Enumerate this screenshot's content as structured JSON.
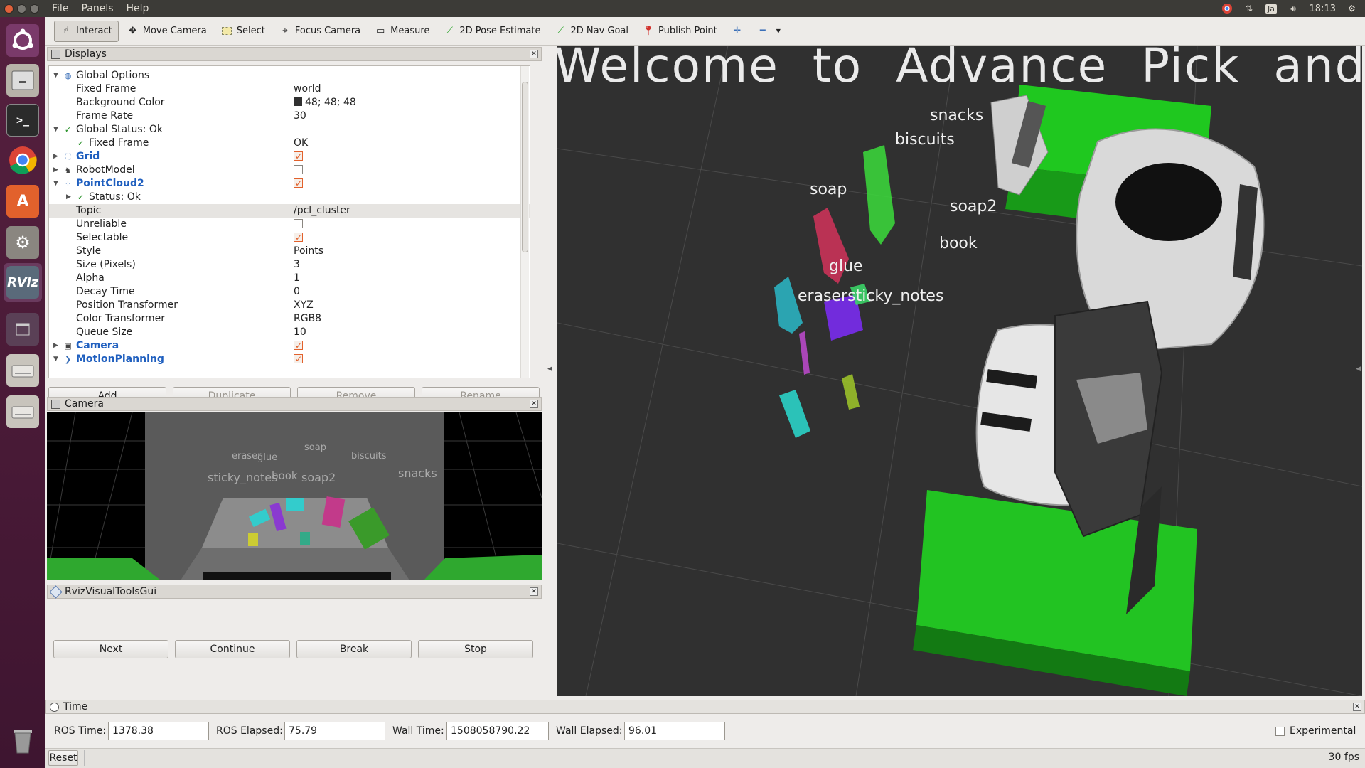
{
  "menubar": {
    "menus": [
      "File",
      "Panels",
      "Help"
    ],
    "clock": "18:13",
    "keyboard": "Ja"
  },
  "toolbar": {
    "tools": [
      {
        "label": "Interact",
        "icon": "hand-icon",
        "active": true
      },
      {
        "label": "Move Camera",
        "icon": "move-camera-icon"
      },
      {
        "label": "Select",
        "icon": "select-icon"
      },
      {
        "label": "Focus Camera",
        "icon": "focus-camera-icon"
      },
      {
        "label": "Measure",
        "icon": "measure-icon"
      },
      {
        "label": "2D Pose Estimate",
        "icon": "pose-arrow-icon"
      },
      {
        "label": "2D Nav Goal",
        "icon": "nav-arrow-icon"
      },
      {
        "label": "Publish Point",
        "icon": "map-pin-icon"
      }
    ]
  },
  "displays": {
    "title": "Displays",
    "rows": [
      {
        "name": "Global Options",
        "value": ""
      },
      {
        "name": "Fixed Frame",
        "value": "world"
      },
      {
        "name": "Background Color",
        "value": "48; 48; 48"
      },
      {
        "name": "Frame Rate",
        "value": "30"
      },
      {
        "name": "Global Status: Ok",
        "value": ""
      },
      {
        "name": "Fixed Frame",
        "value": "OK"
      },
      {
        "name": "Grid",
        "value": ""
      },
      {
        "name": "RobotModel",
        "value": ""
      },
      {
        "name": "PointCloud2",
        "value": ""
      },
      {
        "name": "Status: Ok",
        "value": ""
      },
      {
        "name": "Topic",
        "value": "/pcl_cluster"
      },
      {
        "name": "Unreliable",
        "value": ""
      },
      {
        "name": "Selectable",
        "value": ""
      },
      {
        "name": "Style",
        "value": "Points"
      },
      {
        "name": "Size (Pixels)",
        "value": "3"
      },
      {
        "name": "Alpha",
        "value": "1"
      },
      {
        "name": "Decay Time",
        "value": "0"
      },
      {
        "name": "Position Transformer",
        "value": "XYZ"
      },
      {
        "name": "Color Transformer",
        "value": "RGB8"
      },
      {
        "name": "Queue Size",
        "value": "10"
      },
      {
        "name": "Camera",
        "value": ""
      },
      {
        "name": "MotionPlanning",
        "value": ""
      }
    ],
    "buttons": {
      "add": "Add",
      "duplicate": "Duplicate",
      "remove": "Remove",
      "rename": "Rename"
    },
    "background_color": "#303030"
  },
  "camera_panel": {
    "title": "Camera",
    "labels": [
      "eraser",
      "glue",
      "soap",
      "biscuits",
      "sticky_notes",
      "book",
      "soap2",
      "snacks"
    ]
  },
  "rviz_tools": {
    "title": "RvizVisualToolsGui",
    "buttons": {
      "next": "Next",
      "continue": "Continue",
      "break": "Break",
      "stop": "Stop"
    }
  },
  "view3d": {
    "banner": "Welcome to Advance Pick and Pl",
    "labels": {
      "snacks": "snacks",
      "biscuits": "biscuits",
      "soap": "soap",
      "soap2": "soap2",
      "book": "book",
      "glue": "glue",
      "eraser_sticky": "erasersticky_notes"
    }
  },
  "time": {
    "title": "Time",
    "ros_time_label": "ROS Time:",
    "ros_time": "1378.38",
    "ros_elapsed_label": "ROS Elapsed:",
    "ros_elapsed": "75.79",
    "wall_time_label": "Wall Time:",
    "wall_time": "1508058790.22",
    "wall_elapsed_label": "Wall Elapsed:",
    "wall_elapsed": "96.01",
    "experimental_label": "Experimental"
  },
  "status": {
    "reset": "Reset",
    "fps": "30 fps"
  }
}
